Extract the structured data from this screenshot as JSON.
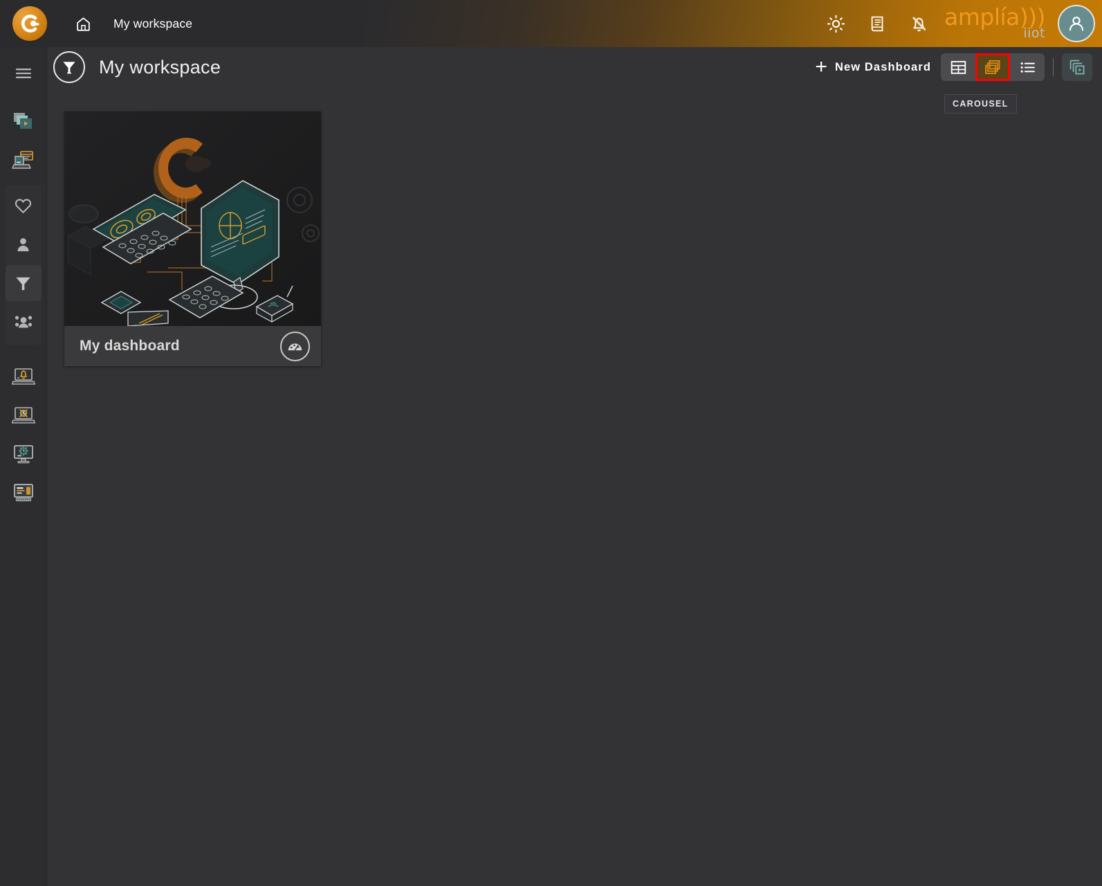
{
  "header": {
    "brand_logo_icon": "amplia-c-logo-icon",
    "home_icon": "home-icon",
    "workspace_label": "My workspace",
    "actions": [
      {
        "name": "theme-toggle",
        "icon": "sun-brightness-icon"
      },
      {
        "name": "documentation",
        "icon": "document-book-icon"
      },
      {
        "name": "notifications-muted",
        "icon": "bell-off-icon"
      }
    ],
    "logo_primary": "amplía)))",
    "logo_secondary": "iiot",
    "avatar_icon": "user-avatar-icon",
    "colors": {
      "gradient_start": "#2b2b2e",
      "gradient_end": "#c47a05",
      "logo_orange": "#f09a1e",
      "avatar_teal": "#678d8e"
    }
  },
  "sidebar": {
    "menu_toggle": {
      "label": "Menu",
      "icon": "hamburger-menu-icon"
    },
    "items": [
      {
        "label": "Dashboards carousel",
        "icon": "cards-play-icon",
        "active": false
      },
      {
        "label": "Workstations",
        "icon": "laptop-window-icon",
        "active": false
      },
      {
        "label": "Favourites",
        "icon": "heart-icon",
        "active": false
      },
      {
        "label": "Profile",
        "icon": "person-icon",
        "active": false
      },
      {
        "label": "My workspace",
        "icon": "funnel-filter-icon",
        "active": true
      },
      {
        "label": "Groups",
        "icon": "people-group-icon",
        "active": false
      },
      {
        "label": "Alarms",
        "icon": "laptop-alarm-icon",
        "active": false
      },
      {
        "label": "Monitoring",
        "icon": "laptop-clock-icon",
        "active": false
      },
      {
        "label": "Settings",
        "icon": "monitor-gear-icon",
        "active": false
      },
      {
        "label": "Console",
        "icon": "monitor-terminal-icon",
        "active": false
      }
    ]
  },
  "toolbar": {
    "title_icon": "funnel-filter-circle-icon",
    "title": "My workspace",
    "new_dashboard_label": "New Dashboard",
    "new_dashboard_plus": "+",
    "view_modes": [
      {
        "name": "grid",
        "icon": "table-grid-icon",
        "selected": false
      },
      {
        "name": "carousel",
        "icon": "stacked-cards-icon",
        "selected": true
      },
      {
        "name": "list",
        "icon": "list-icon",
        "selected": false
      }
    ],
    "play_carousel": {
      "name": "play-carousel",
      "icon": "cards-play-icon"
    },
    "tooltip": "CAROUSEL",
    "selected_highlight_color": "#ff0000",
    "selected_icon_color": "#d98a12"
  },
  "dashboards": [
    {
      "name": "My dashboard",
      "thumbnail_alt": "isometric-workstation-illustration",
      "badge_icon": "gauge-dashboard-icon"
    }
  ]
}
